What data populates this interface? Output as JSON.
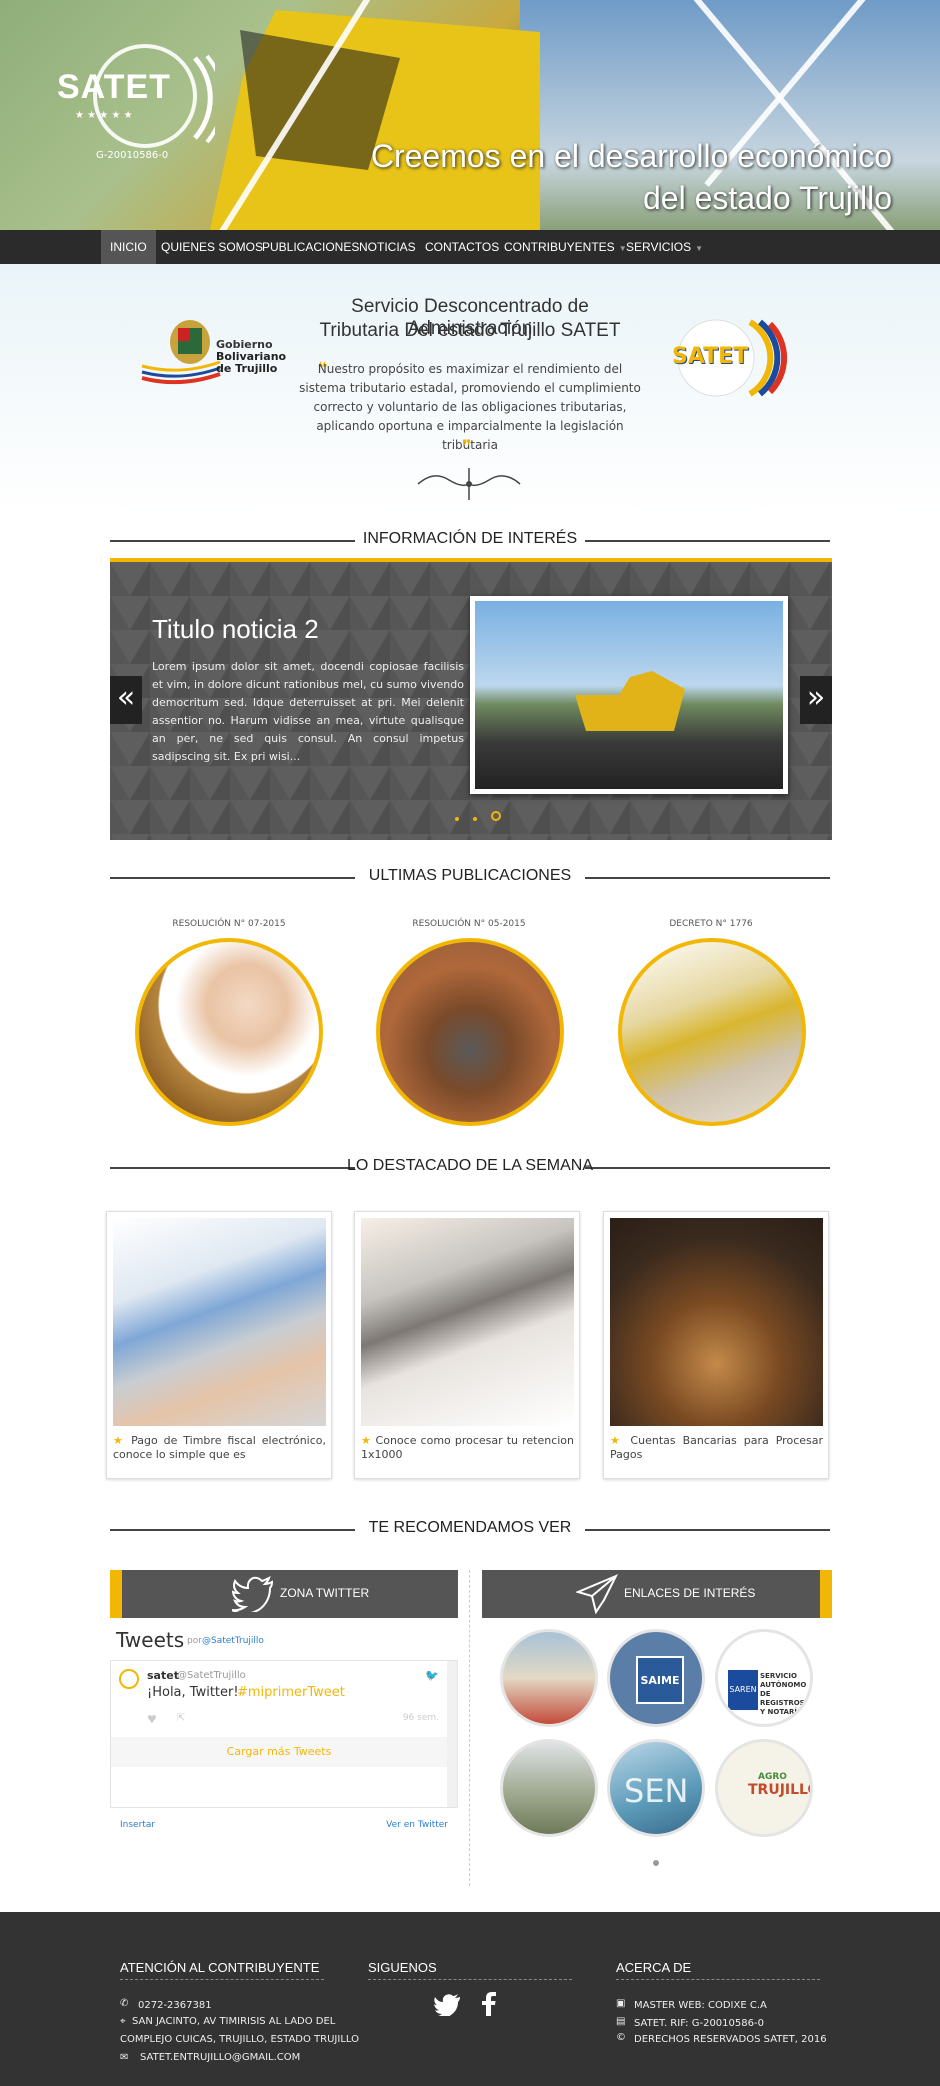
{
  "header": {
    "logo_text": "SATET",
    "logo_rif": "G-20010586-0",
    "slogan_line1": "Creemos en el desarrollo económico",
    "slogan_line2": "del estado Trujillo"
  },
  "nav": {
    "items": [
      "INICIO",
      "QUIENES SOMOS",
      "PUBLICACIONES",
      "NOTICIAS",
      "CONTACTOS",
      "CONTRIBUYENTES",
      "SERVICIOS"
    ]
  },
  "intro": {
    "gob_line1": "Gobierno",
    "gob_line2": "Bolivariano",
    "gob_line3": "de Trujillo",
    "title_line1": "Servicio Desconcentrado de Administración",
    "title_line2": "Tributaria Del estado Trujillo SATET",
    "quote": "Nuestro propósito es maximizar el rendimiento del sistema tributario estadal, promoviendo el cumplimiento correcto y voluntario de las obligaciones tributarias, aplicando oportuna e imparcialmente la legislación tributaria",
    "satet_logo_text": "SATET"
  },
  "sections": {
    "info": "INFORMACIÓN DE INTERÉS",
    "pubs": "ULTIMAS PUBLICACIONES",
    "destacado": "LO DESTACADO DE LA SEMANA",
    "recomendamos": "TE RECOMENDAMOS VER"
  },
  "slider": {
    "title": "Titulo noticia 2",
    "body": "Lorem ipsum dolor sit amet, docendi copiosae facilisis et vim, in dolore dicunt rationibus mel, cu sumo vivendo democritum sed. Idque deterruisset at pri. Mei delenit assentior no. Harum vidisse an mea, virtute qualisque an per, ne sed quis consul. An consul impetus sadipscing sit. Ex pri wisi...",
    "prev": "«",
    "next": "»"
  },
  "publications": [
    "RESOLUCIÓN N° 07-2015",
    "RESOLUCIÓN N° 05-2015",
    "DECRETO N° 1776"
  ],
  "featured": [
    "Pago de Timbre fiscal electrónico, conoce lo simple que es",
    "Conoce como procesar tu retencion 1x1000",
    "Cuentas Bancarias para Procesar Pagos"
  ],
  "twitter": {
    "zone_title": "ZONA TWITTER",
    "tweets_label": "Tweets",
    "by_label": "por",
    "by_handle": "@SatetTrujillo",
    "user_name": "satet",
    "user_handle": "@SatetTrujillo",
    "tweet_text": "¡Hola, Twitter!",
    "tweet_hashtag": "#miprimerTweet",
    "tweet_age": "96 sem.",
    "load_more": "Cargar más Tweets",
    "embed": "Insertar",
    "view_on": "Ver en Twitter"
  },
  "links": {
    "title": "ENLACES DE INTERÉS",
    "saime": "SAIME",
    "saren": "SAREN",
    "saren_detail": "SERVICIO AUTÓNOMO DE REGISTROS Y NOTARÍAS",
    "seniat": "SEN",
    "agro": "AGRO",
    "agro2": "TRUJILLO"
  },
  "footer": {
    "col1_title": "ATENCIÓN AL CONTRIBUYENTE",
    "phone": "0272-2367381",
    "address_line1": "SAN JACINTO, AV TIMIRISIS AL LADO DEL",
    "address_line2": "COMPLEJO CUICAS, TRUJILLO, ESTADO TRUJILLO",
    "email": "SATET.ENTRUJILLO@GMAIL.COM",
    "col2_title": "SIGUENOS",
    "col3_title": "ACERCA DE",
    "master": "MASTER WEB: CODIXE C.A",
    "rif": "SATET. RIF: G-20010586-0",
    "rights": "DERECHOS RESERVADOS SATET, 2016"
  },
  "colors": {
    "accent": "#f2b705",
    "nav_bg": "#2b2b2b",
    "footer_bg": "#333333",
    "link": "#2a7fcf"
  }
}
